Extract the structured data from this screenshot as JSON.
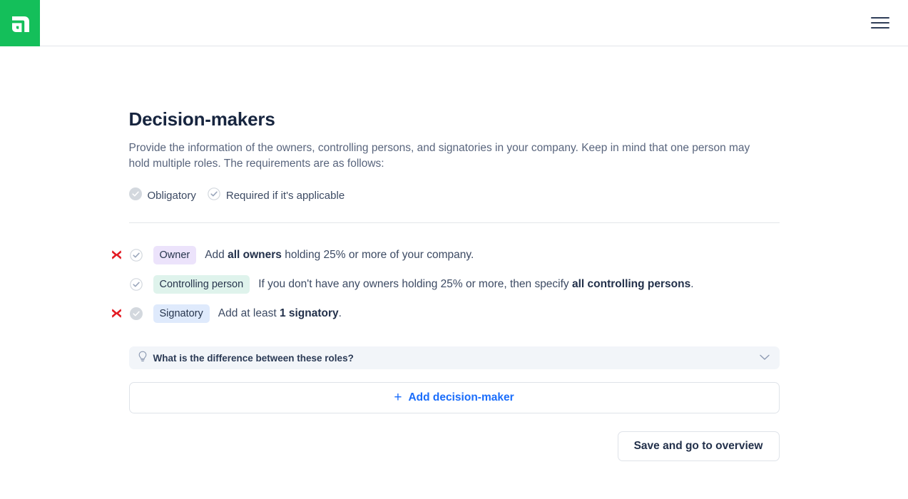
{
  "header": {
    "logo_icon": "company-logo-icon",
    "logo_color": "#14bf5a",
    "menu_icon": "hamburger-menu-icon"
  },
  "main": {
    "title": "Decision-makers",
    "description": "Provide the information of the owners, controlling persons, and signatories in your company. Keep in mind that one person may hold multiple roles. The requirements are as follows:",
    "legend": [
      {
        "icon": "check-circle-filled-icon",
        "label": "Obligatory",
        "style": "filled"
      },
      {
        "icon": "check-circle-outline-icon",
        "label": "Required if it's applicable",
        "style": "outline"
      }
    ],
    "roles": [
      {
        "badge": "Owner",
        "badge_color": "#ece3fb",
        "check_style": "outline",
        "check_icon": "check-circle-outline-icon",
        "error_icon": "error-cross-icon",
        "has_error": true,
        "text_before": "Add ",
        "text_bold": "all owners",
        "text_after": " holding 25% or more of your company."
      },
      {
        "badge": "Controlling person",
        "badge_color": "#dff3ec",
        "check_style": "outline",
        "check_icon": "check-circle-outline-icon",
        "error_icon": "error-cross-icon",
        "has_error": false,
        "text_before": "If you don't have any owners holding 25% or more, then specify ",
        "text_bold": "all controlling persons",
        "text_after": "."
      },
      {
        "badge": "Signatory",
        "badge_color": "#dfeafc",
        "check_style": "filled",
        "check_icon": "check-circle-filled-icon",
        "error_icon": "error-cross-icon",
        "has_error": true,
        "text_before": "Add at least ",
        "text_bold": "1 signatory",
        "text_after": "."
      }
    ],
    "accordion": {
      "icon": "lightbulb-icon",
      "title": "What is the difference between these roles?",
      "chevron_icon": "chevron-down-icon"
    },
    "add_button": {
      "icon": "plus-icon",
      "plus": "+",
      "label": "Add decision-maker",
      "color": "#1a6dfb"
    },
    "save_button": {
      "label": "Save and go to overview"
    }
  }
}
